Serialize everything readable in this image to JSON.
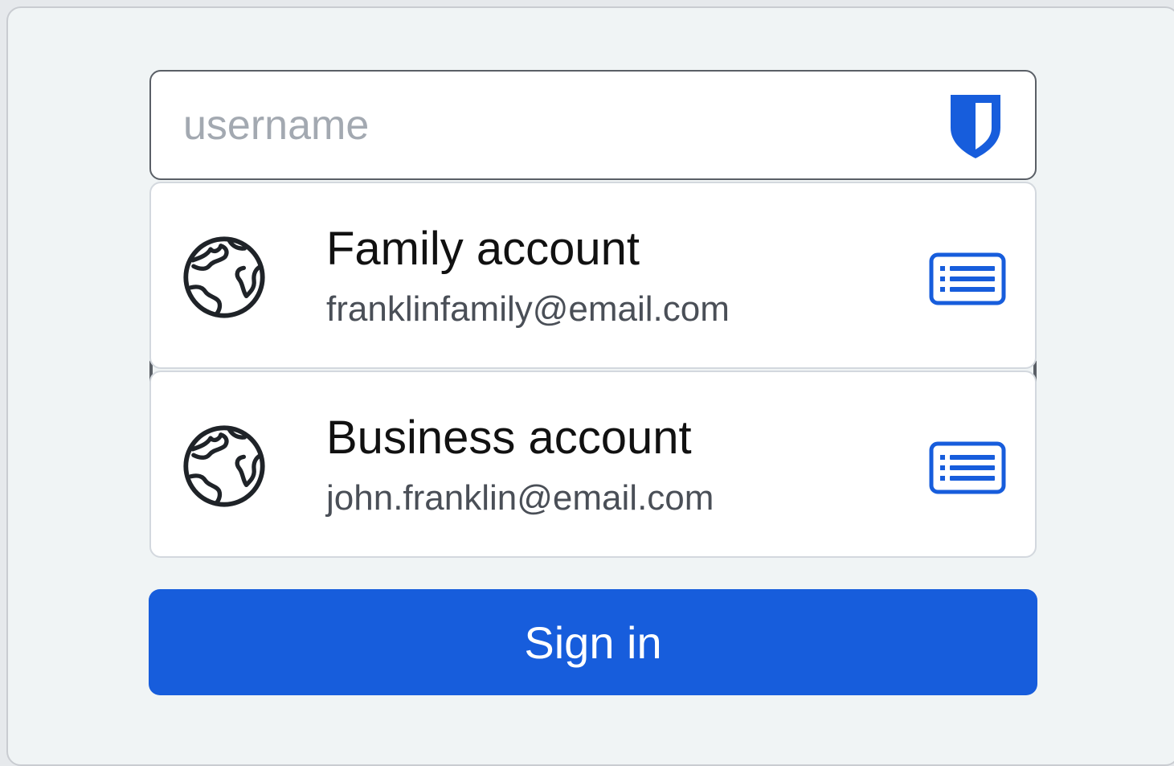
{
  "username_field": {
    "placeholder": "username",
    "value": "",
    "icon": "bitwarden-shield-icon"
  },
  "accounts": [
    {
      "name": "Family account",
      "email": "franklinfamily@email.com",
      "icon": "globe-icon",
      "action_icon": "list-card-icon"
    },
    {
      "name": "Business account",
      "email": "john.franklin@email.com",
      "icon": "globe-icon",
      "action_icon": "list-card-icon"
    }
  ],
  "sign_in_button": {
    "label": "Sign in"
  },
  "colors": {
    "accent": "#175ddc",
    "background": "#f0f4f5",
    "field_border": "#5a5f66",
    "placeholder": "#a3a9b1",
    "secondary_text": "#4a4f57"
  }
}
